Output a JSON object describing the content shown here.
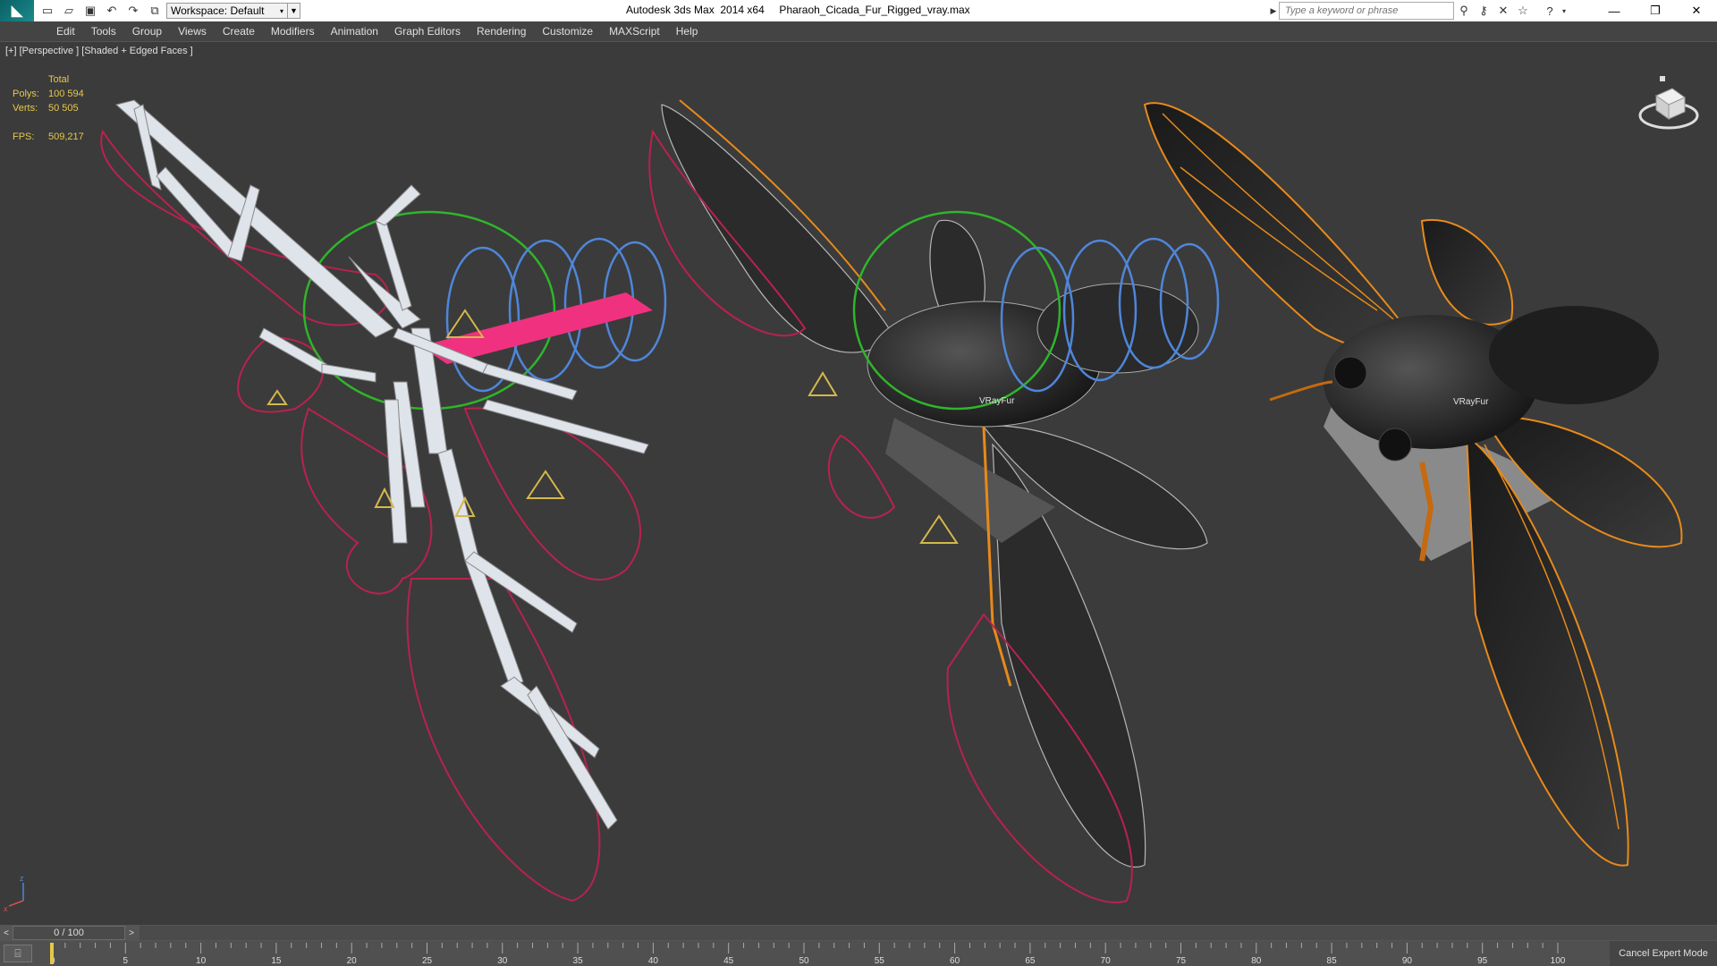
{
  "titlebar": {
    "workspace_label": "Workspace: Default",
    "title": "Autodesk 3ds Max  2014 x64     Pharaoh_Cicada_Fur_Rigged_vray.max",
    "search_placeholder": "Type a keyword or phrase",
    "quick_access_icons": [
      "new-icon",
      "open-icon",
      "save-icon",
      "undo-icon",
      "redo-icon",
      "project-icon"
    ],
    "window_controls": [
      "minimize",
      "maximize",
      "close"
    ]
  },
  "menu": {
    "items": [
      "Edit",
      "Tools",
      "Group",
      "Views",
      "Create",
      "Modifiers",
      "Animation",
      "Graph Editors",
      "Rendering",
      "Customize",
      "MAXScript",
      "Help"
    ]
  },
  "viewport": {
    "label": "[+] [Perspective ] [Shaded + Edged Faces ]",
    "stats": {
      "total_label": "Total",
      "polys_label": "Polys:",
      "polys_value": "100 594",
      "verts_label": "Verts:",
      "verts_value": "50 505",
      "fps_label": "FPS:",
      "fps_value": "509,217"
    },
    "fur_label_1": "VRayFur",
    "fur_label_2": "VRayFur",
    "axis_z": "z",
    "axis_x": "x"
  },
  "colors": {
    "viewport_bg": "#3b3b3b",
    "stats_text": "#e7c74a",
    "spline_red": "#b8224e",
    "control_green": "#2fb52a",
    "control_blue": "#4f86d9",
    "bone_pink": "#f0317f",
    "wing_orange": "#e88a1a"
  },
  "timeslider": {
    "frame_display": "0 / 100",
    "prev": "<",
    "next": ">"
  },
  "trackbar": {
    "ticks": [
      "0",
      "5",
      "10",
      "15",
      "20",
      "25",
      "30",
      "35",
      "40",
      "45",
      "50",
      "55",
      "60",
      "65",
      "70",
      "75",
      "80",
      "85",
      "90",
      "95",
      "100"
    ],
    "cancel_expert_label": "Cancel Expert Mode"
  }
}
